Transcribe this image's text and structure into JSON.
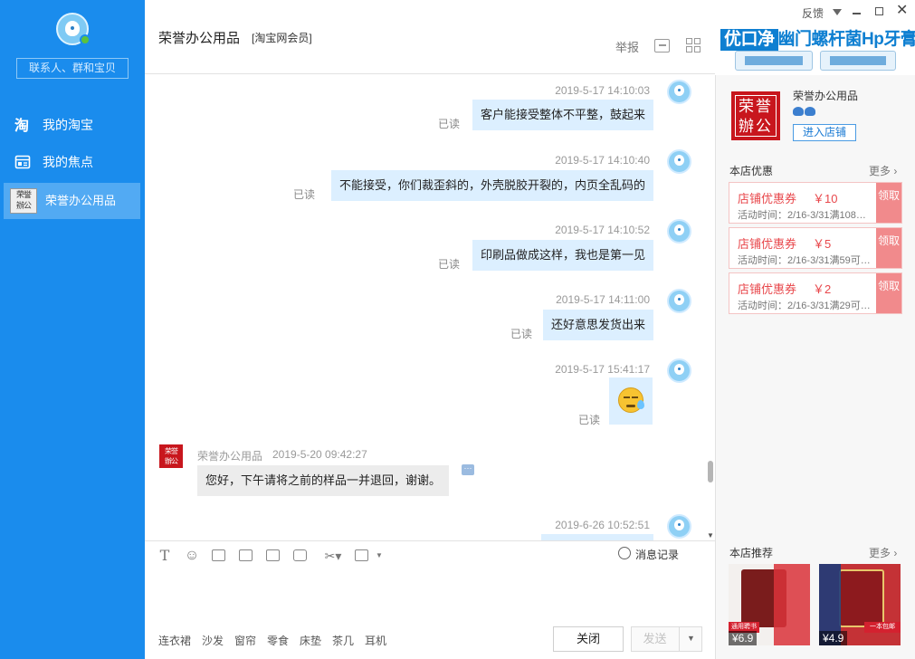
{
  "sidebar": {
    "search_placeholder": "联系人、群和宝贝",
    "items": [
      {
        "label": "我的淘宝",
        "icon": "taobao-icon"
      },
      {
        "label": "我的焦点",
        "icon": "focus-icon"
      },
      {
        "label": "荣誉办公用品",
        "icon": "shop-seal-avatar"
      }
    ]
  },
  "header": {
    "title": "荣誉办公用品",
    "member_tag": "[淘宝网会员]",
    "report_label": "举报"
  },
  "window": {
    "feedback_label": "反馈"
  },
  "ad": {
    "brand": "优口净",
    "text": "幽门螺杆菌Hp牙膏"
  },
  "messages": [
    {
      "from": "me",
      "time": "2019-5-17 14:10:03",
      "text": "客户能接受整体不平整，鼓起来",
      "status": "已读"
    },
    {
      "from": "me",
      "time": "2019-5-17 14:10:40",
      "text": "不能接受，你们裁歪斜的，外壳脱胶开裂的，内页全乱码的",
      "status": "已读"
    },
    {
      "from": "me",
      "time": "2019-5-17 14:10:52",
      "text": "印刷品做成这样，我也是第一见",
      "status": "已读"
    },
    {
      "from": "me",
      "time": "2019-5-17 14:11:00",
      "text": "还好意思发货出来",
      "status": "已读"
    },
    {
      "from": "me",
      "time": "2019-5-17 15:41:17",
      "text": "",
      "emoji": "sweat-smile-emoji",
      "status": "已读"
    },
    {
      "from": "shop",
      "sender": "荣誉办公用品",
      "time": "2019-5-20 09:42:27",
      "text": "您好，下午请将之前的样品一并退回，谢谢。"
    },
    {
      "from": "me",
      "time": "2019-6-26 10:52:51",
      "text": ""
    }
  ],
  "seal_text": {
    "line1": "荣誉",
    "line2": "辦公"
  },
  "input": {
    "history_label": "消息记录",
    "quick_phrases": [
      "连衣裙",
      "沙发",
      "窗帘",
      "零食",
      "床垫",
      "茶几",
      "耳机"
    ],
    "close_label": "关闭",
    "send_label": "发送"
  },
  "right_panel": {
    "shop_name": "荣誉办公用品",
    "enter_shop_label": "进入店铺",
    "coupons_title": "本店优惠",
    "more_label": "更多",
    "coupons": [
      {
        "title": "店铺优惠券",
        "amount": "￥10",
        "desc": "活动时间：2/16-3/31满108…",
        "action": "领取"
      },
      {
        "title": "店铺优惠券",
        "amount": "￥5",
        "desc": "活动时间：2/16-3/31满59可…",
        "action": "领取"
      },
      {
        "title": "店铺优惠券",
        "amount": "￥2",
        "desc": "活动时间：2/16-3/31满29可…",
        "action": "领取"
      }
    ],
    "recommend_title": "本店推荐",
    "recommend_items": [
      {
        "price": "¥6.9",
        "tag": "通用聘书"
      },
      {
        "price": "¥4.9",
        "tag": "一本包邮"
      }
    ]
  },
  "colors": {
    "sidebar": "#1a8ced",
    "bubble_me": "#dcefff",
    "bubble_shop": "#ececec",
    "coupon_red": "#e8474b"
  }
}
